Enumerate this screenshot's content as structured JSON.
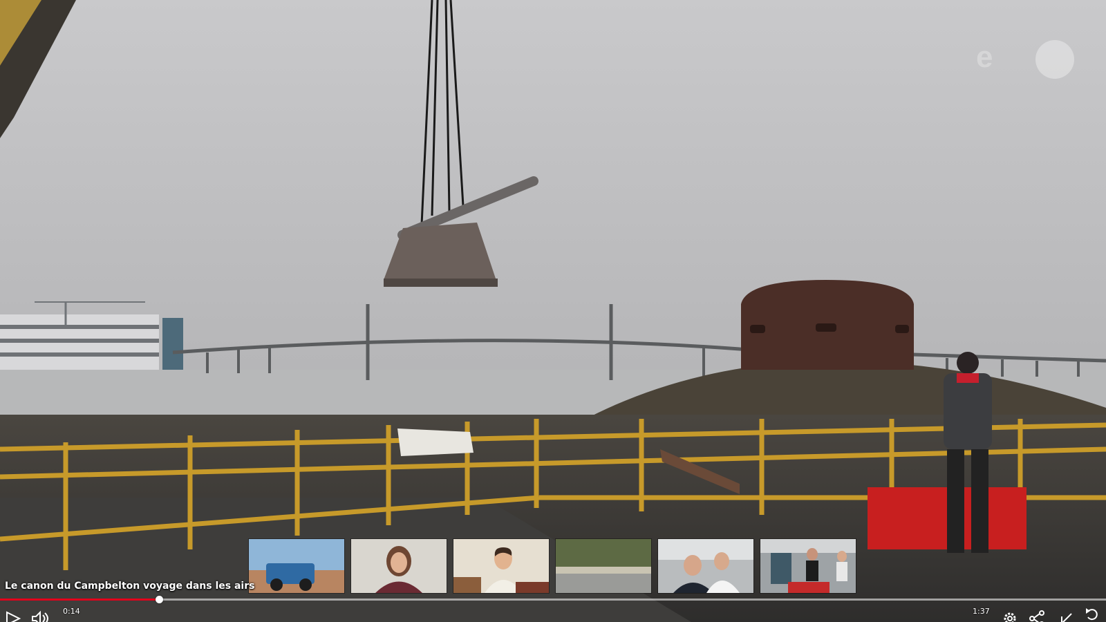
{
  "video": {
    "title": "Le canon du Campbelton voyage dans les airs",
    "current_time": "0:14",
    "duration": "1:37",
    "progress_fraction": 0.144,
    "accent_color": "#e3001b",
    "watermark_text": "e"
  },
  "related_videos": [
    {
      "name": "thumb-tractor",
      "subject": "blue telehandler tractor"
    },
    {
      "name": "thumb-woman",
      "subject": "woman smiling indoors"
    },
    {
      "name": "thumb-young-man",
      "subject": "young man with books"
    },
    {
      "name": "thumb-landscape",
      "subject": "countryside road"
    },
    {
      "name": "thumb-officers",
      "subject": "officers at computer"
    },
    {
      "name": "thumb-workshop",
      "subject": "people in workshop"
    }
  ],
  "controls": {
    "play_icon": "play-icon",
    "volume_icon": "volume-icon",
    "settings_icon": "gear-icon",
    "share_icon": "share-icon",
    "exit_fullscreen_icon": "exit-fullscreen-icon",
    "replay_icon": "replay-icon"
  }
}
